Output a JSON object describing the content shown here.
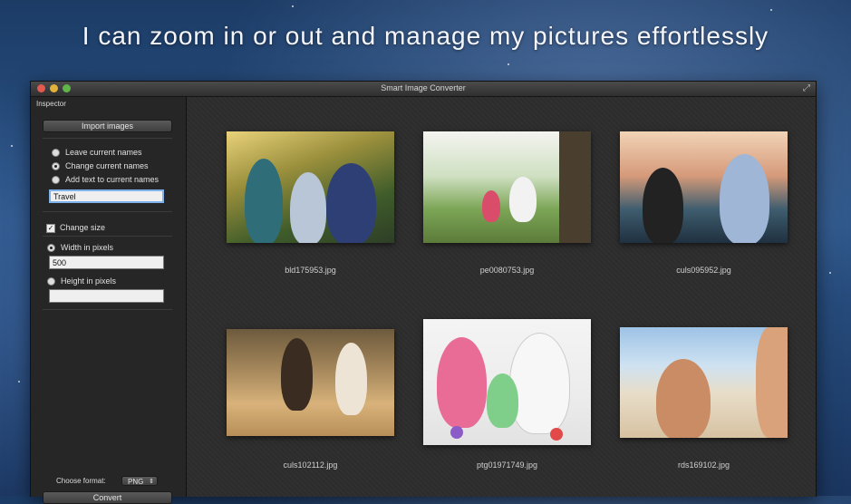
{
  "headline": "I can zoom in or out and manage my pictures effortlessly",
  "window": {
    "title": "Smart Image Converter"
  },
  "sidebar": {
    "inspector_label": "Inspector",
    "import_button": "Import images",
    "naming": {
      "options": [
        "Leave current names",
        "Change current names",
        "Add text to current names"
      ],
      "selected_index": 1,
      "text_value": "Travel"
    },
    "change_size": {
      "label": "Change size",
      "checked": true
    },
    "width": {
      "label": "Width in pixels",
      "value": "500",
      "selected": true
    },
    "height": {
      "label": "Height in pixels",
      "value": "",
      "selected": false
    },
    "format_label": "Choose format:",
    "format_value": "PNG",
    "convert_button": "Convert"
  },
  "images": [
    {
      "filename": "bld175953.jpg",
      "icon": "family-photo"
    },
    {
      "filename": "pe0080753.jpg",
      "icon": "park-photo"
    },
    {
      "filename": "culs095952.jpg",
      "icon": "celebration-photo"
    },
    {
      "filename": "culs102112.jpg",
      "icon": "beach-run-photo"
    },
    {
      "filename": "ptg01971749.jpg",
      "icon": "family-play-photo"
    },
    {
      "filename": "rds169102.jpg",
      "icon": "sunscreen-photo"
    }
  ],
  "colors": {
    "accent_focus": "#7fb2ea",
    "window_bg": "#2a2a2a",
    "close": "#e25a4f",
    "minimize": "#e2b13b",
    "maximize": "#5fb548"
  }
}
